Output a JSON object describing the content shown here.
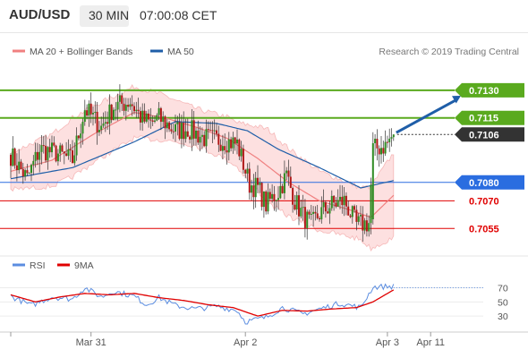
{
  "header": {
    "symbol": "AUD/USD",
    "timeframe": "30 MIN",
    "time": "07:00:08 CET"
  },
  "legend": {
    "ma20_label": "MA 20 + Bollinger Bands",
    "ma50_label": "MA 50",
    "ma20_color": "#f08080",
    "ma50_color": "#1f5ea8",
    "copyright": "Research © 2019 Trading Central"
  },
  "rsi_legend": {
    "rsi_label": "RSI",
    "ma_label": "9MA",
    "rsi_color": "#5b8de0",
    "ma_color": "#e00000"
  },
  "levels": [
    {
      "label": "0.7130",
      "value": 0.713,
      "type": "resistance",
      "color": "#5aaa1e"
    },
    {
      "label": "0.7115",
      "value": 0.7115,
      "type": "resistance",
      "color": "#5aaa1e"
    },
    {
      "label": "0.7106",
      "value": 0.7106,
      "type": "current",
      "color": "#333333"
    },
    {
      "label": "0.7080",
      "value": 0.708,
      "type": "pivot",
      "color": "#2a6de0"
    },
    {
      "label": "0.7070",
      "value": 0.707,
      "type": "support",
      "color": "#e00000"
    },
    {
      "label": "0.7055",
      "value": 0.7055,
      "type": "support",
      "color": "#e00000"
    }
  ],
  "chart_data": {
    "type": "candlestick",
    "price_range": [
      0.7043,
      0.7144
    ],
    "x_labels": [
      {
        "label": "Mar 31",
        "bar": 39
      },
      {
        "label": "Apr 2",
        "bar": 114
      },
      {
        "label": "Apr 3",
        "bar": 183
      },
      {
        "label": "Apr 11",
        "bar": 204
      }
    ],
    "bar_count": 200,
    "close_start": 0.7095,
    "path_anchors": [
      [
        0,
        0.7095
      ],
      [
        8,
        0.7082
      ],
      [
        14,
        0.7098
      ],
      [
        22,
        0.7096
      ],
      [
        30,
        0.7092
      ],
      [
        36,
        0.712
      ],
      [
        44,
        0.711
      ],
      [
        50,
        0.7121
      ],
      [
        58,
        0.7124
      ],
      [
        64,
        0.7114
      ],
      [
        68,
        0.7112
      ],
      [
        72,
        0.7115
      ],
      [
        80,
        0.7108
      ],
      [
        86,
        0.7109
      ],
      [
        94,
        0.7104
      ],
      [
        102,
        0.7103
      ],
      [
        110,
        0.7101
      ],
      [
        116,
        0.7079
      ],
      [
        120,
        0.7077
      ],
      [
        124,
        0.7068
      ],
      [
        130,
        0.7075
      ],
      [
        134,
        0.7084
      ],
      [
        138,
        0.707
      ],
      [
        142,
        0.7062
      ],
      [
        146,
        0.7057
      ],
      [
        150,
        0.7063
      ],
      [
        156,
        0.7068
      ],
      [
        162,
        0.707
      ],
      [
        168,
        0.7057
      ],
      [
        174,
        0.7058
      ],
      [
        176,
        0.7098
      ],
      [
        182,
        0.71
      ],
      [
        186,
        0.7106
      ]
    ],
    "ma20_anchors": [
      [
        0,
        0.7086
      ],
      [
        20,
        0.7092
      ],
      [
        40,
        0.7106
      ],
      [
        60,
        0.7118
      ],
      [
        75,
        0.7115
      ],
      [
        90,
        0.711
      ],
      [
        105,
        0.7104
      ],
      [
        120,
        0.7093
      ],
      [
        135,
        0.708
      ],
      [
        150,
        0.707
      ],
      [
        165,
        0.7065
      ],
      [
        175,
        0.7061
      ],
      [
        186,
        0.7073
      ]
    ],
    "bb_width_anchors": [
      [
        0,
        0.001
      ],
      [
        30,
        0.0016
      ],
      [
        60,
        0.0014
      ],
      [
        90,
        0.001
      ],
      [
        110,
        0.0012
      ],
      [
        125,
        0.002
      ],
      [
        150,
        0.0016
      ],
      [
        170,
        0.0014
      ],
      [
        186,
        0.0023
      ]
    ],
    "ma50_anchors": [
      [
        0,
        0.7082
      ],
      [
        30,
        0.7088
      ],
      [
        60,
        0.7102
      ],
      [
        80,
        0.7113
      ],
      [
        100,
        0.7112
      ],
      [
        115,
        0.7108
      ],
      [
        130,
        0.7098
      ],
      [
        150,
        0.7088
      ],
      [
        170,
        0.7077
      ],
      [
        186,
        0.7081
      ]
    ],
    "rsi_anchors": [
      [
        0,
        58
      ],
      [
        10,
        45
      ],
      [
        20,
        57
      ],
      [
        30,
        54
      ],
      [
        36,
        70
      ],
      [
        44,
        57
      ],
      [
        50,
        65
      ],
      [
        60,
        58
      ],
      [
        66,
        46
      ],
      [
        72,
        56
      ],
      [
        80,
        45
      ],
      [
        90,
        40
      ],
      [
        100,
        44
      ],
      [
        110,
        38
      ],
      [
        114,
        22
      ],
      [
        124,
        28
      ],
      [
        132,
        42
      ],
      [
        142,
        33
      ],
      [
        150,
        40
      ],
      [
        160,
        48
      ],
      [
        170,
        42
      ],
      [
        176,
        71
      ],
      [
        186,
        72
      ]
    ],
    "rsi_ma_anchors": [
      [
        0,
        60
      ],
      [
        12,
        50
      ],
      [
        24,
        57
      ],
      [
        36,
        62
      ],
      [
        48,
        60
      ],
      [
        60,
        62
      ],
      [
        72,
        56
      ],
      [
        84,
        52
      ],
      [
        96,
        46
      ],
      [
        108,
        42
      ],
      [
        120,
        30
      ],
      [
        132,
        38
      ],
      [
        144,
        37
      ],
      [
        156,
        40
      ],
      [
        168,
        42
      ],
      [
        176,
        50
      ],
      [
        186,
        67
      ]
    ],
    "rsi_current": 70,
    "rsi_ticks": [
      70,
      50,
      30
    ],
    "rsi_range": [
      15,
      82
    ],
    "projection": {
      "from_bar": 186,
      "from": 0.7107,
      "to_bar": 210,
      "to": 0.7127
    }
  }
}
